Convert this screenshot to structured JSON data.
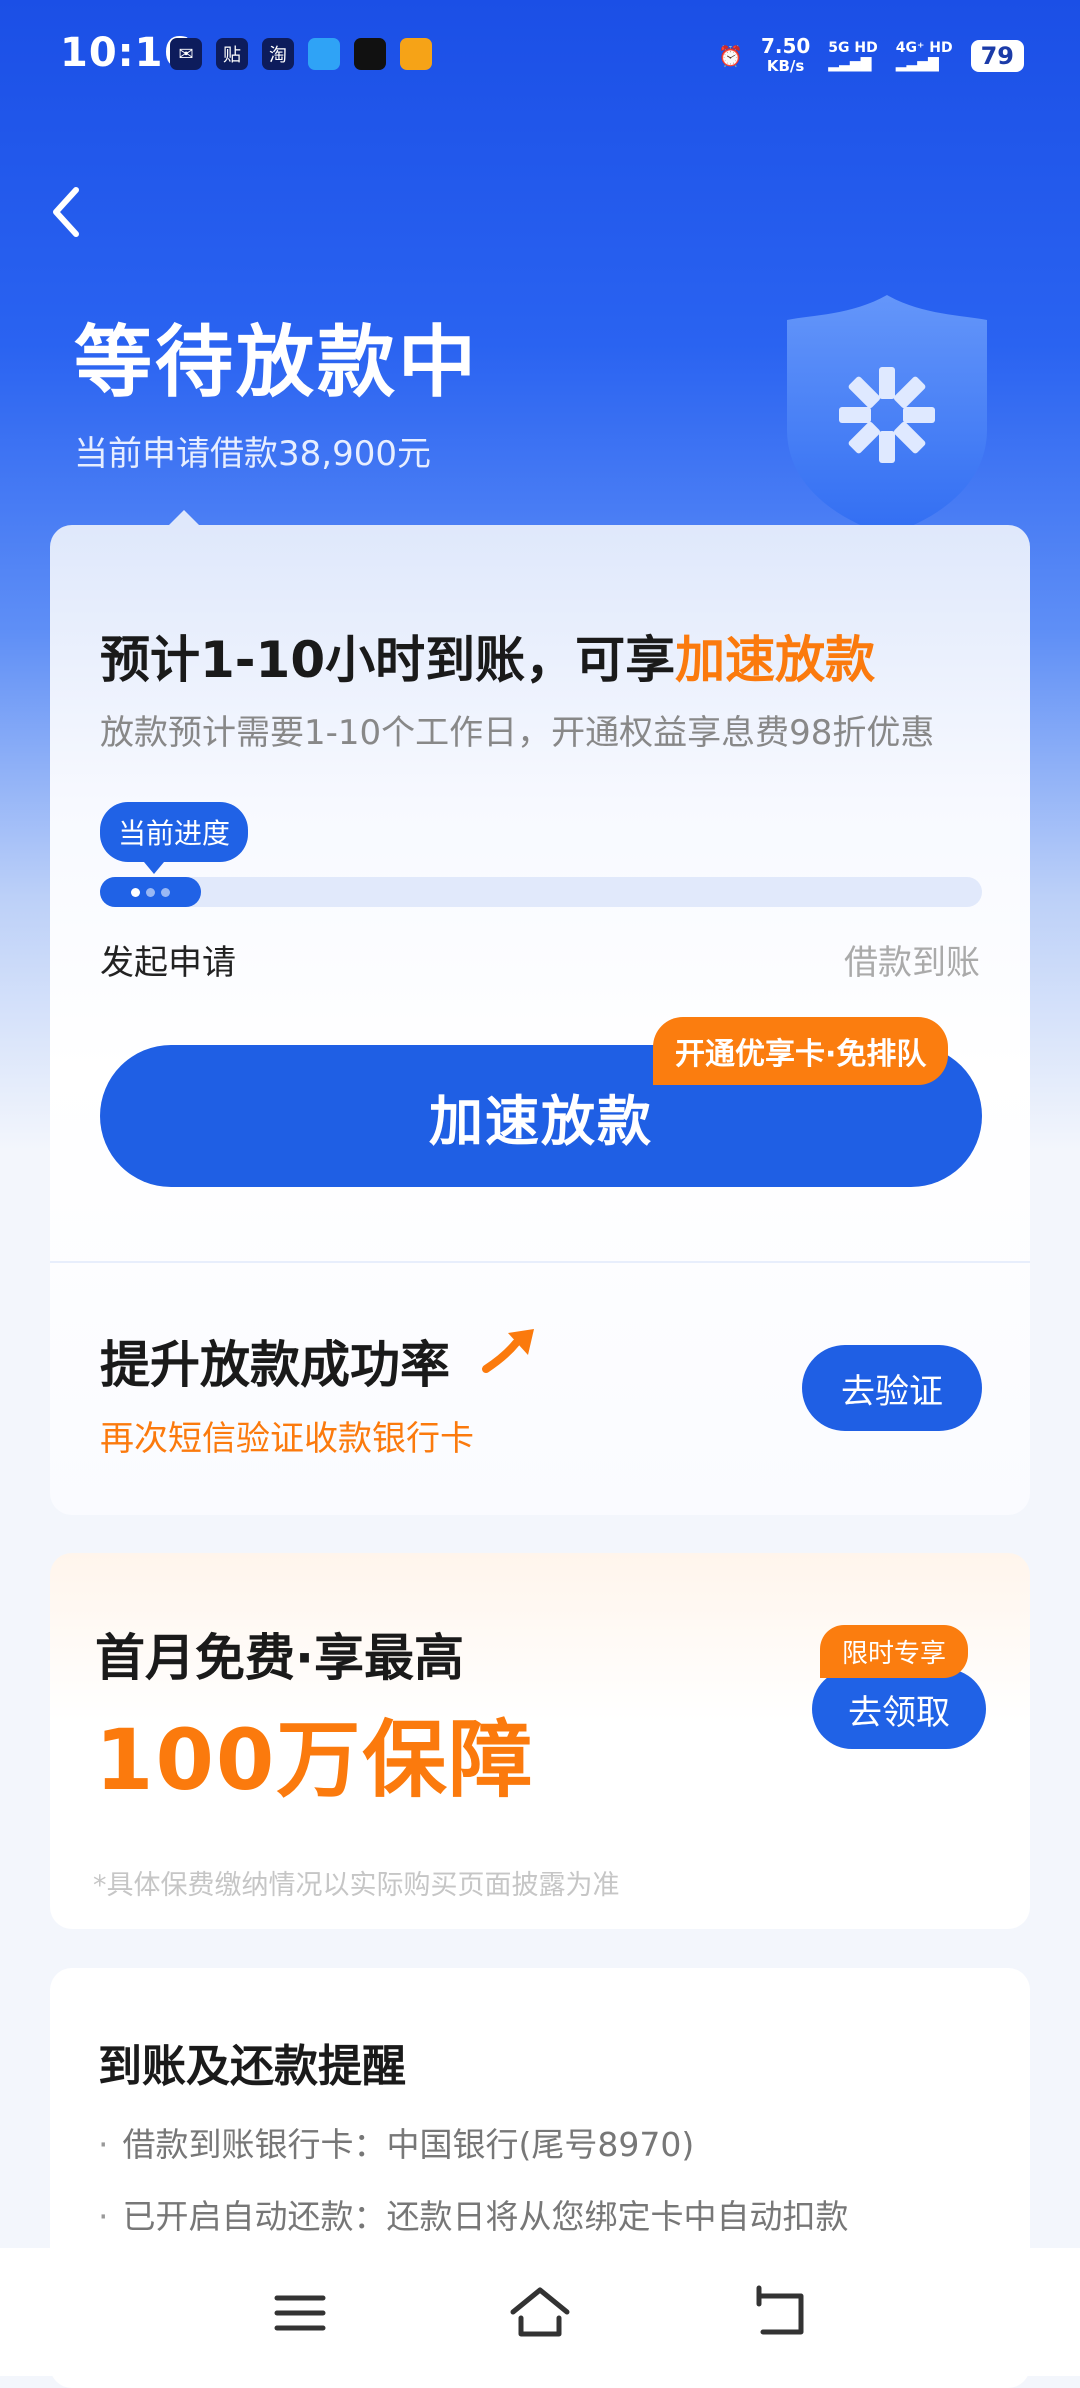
{
  "status_bar": {
    "time": "10:16",
    "speed_value": "7.50",
    "speed_unit": "KB/s",
    "sig1_top": "5G HD",
    "sig2_top": "4G⁺ HD",
    "battery": "79",
    "app_icon_labels": [
      "贴",
      "淘"
    ]
  },
  "header": {
    "title": "等待放款中",
    "subtitle": "当前申请借款38,900元"
  },
  "progress_card": {
    "headline_prefix": "预计1-10小时到账，可享",
    "headline_accent": "加速放款",
    "description": "放款预计需要1-10个工作日，开通权益享息费98折优惠",
    "progress_label": "当前进度",
    "progress_fraction": 0.115,
    "step_start": "发起申请",
    "step_end": "借款到账",
    "main_button": "加速放款",
    "tag": "开通优享卡·免排队"
  },
  "verify_section": {
    "title": "提升放款成功率",
    "subtitle": "再次短信验证收款银行卡",
    "button": "去验证"
  },
  "insurance_card": {
    "line1": "首月免费·享最高",
    "line2": "100万保障",
    "tag": "限时专享",
    "button": "去领取",
    "note": "*具体保费缴纳情况以实际购买页面披露为准"
  },
  "reminder_card": {
    "title": "到账及还款提醒",
    "items": [
      "借款到账银行卡：中国银行(尾号8970)",
      "已开启自动还款：还款日将从您绑定卡中自动扣款"
    ]
  },
  "colors": {
    "primary": "#1f5fe4",
    "accent_orange": "#fb7a0d"
  }
}
